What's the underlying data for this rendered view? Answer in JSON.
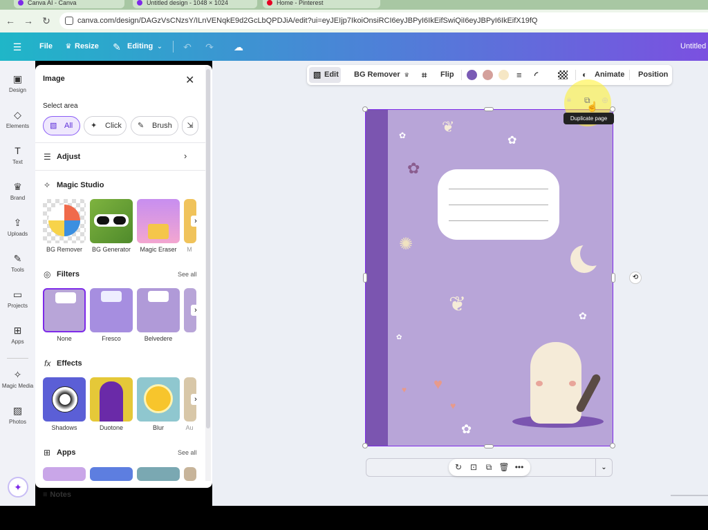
{
  "browser": {
    "tabs": [
      {
        "label": "Canva AI - Canva"
      },
      {
        "label": "Untitled design - 1048 × 1024"
      },
      {
        "label": "Home - Pinterest"
      }
    ],
    "url": "canva.com/design/DAGzVsCNzsY/ILnVENqkE9d2GcLbQPDJiA/edit?ui=eyJEIjp7IkoiOnsiRCI6eyJBPyI6IkEifSwiQiI6eyJBPyI6IkEifX19fQ"
  },
  "header": {
    "file_label": "File",
    "resize_label": "Resize",
    "editing_label": "Editing",
    "doc_title": "Untitled"
  },
  "rail": {
    "items": [
      {
        "label": "Design",
        "icon": "design-icon"
      },
      {
        "label": "Elements",
        "icon": "elements-icon"
      },
      {
        "label": "Text",
        "icon": "text-icon"
      },
      {
        "label": "Brand",
        "icon": "brand-icon"
      },
      {
        "label": "Uploads",
        "icon": "uploads-icon"
      },
      {
        "label": "Tools",
        "icon": "tools-icon"
      },
      {
        "label": "Projects",
        "icon": "projects-icon"
      },
      {
        "label": "Apps",
        "icon": "apps-icon"
      },
      {
        "label": "Magic Media",
        "icon": "magic-media-icon"
      },
      {
        "label": "Photos",
        "icon": "photos-icon"
      }
    ]
  },
  "panel": {
    "title": "Image",
    "select_area_label": "Select area",
    "select_modes": [
      "All",
      "Click",
      "Brush"
    ],
    "adjust_label": "Adjust",
    "magic_studio_label": "Magic Studio",
    "magic_tools": [
      "BG Remover",
      "BG Generator",
      "Magic Eraser",
      "M"
    ],
    "filters_label": "Filters",
    "filters_see_all": "See all",
    "filters": [
      "None",
      "Fresco",
      "Belvedere"
    ],
    "effects_label": "Effects",
    "effects": [
      "Shadows",
      "Duotone",
      "Blur",
      "Au"
    ],
    "apps_label": "Apps",
    "apps_see_all": "See all"
  },
  "toolbar": {
    "edit_label": "Edit",
    "bg_remover_label": "BG Remover",
    "flip_label": "Flip",
    "animate_label": "Animate",
    "position_label": "Position",
    "colors": [
      "#7a5bb5",
      "#d4a09b",
      "#f6e7c5"
    ]
  },
  "tooltip": {
    "text": "Duplicate page"
  },
  "footer": {
    "notes_label": "Notes"
  },
  "colors": {
    "accent": "#7d2ae8",
    "page_bg": "#b8a5d8",
    "spine": "#7b55b0"
  }
}
